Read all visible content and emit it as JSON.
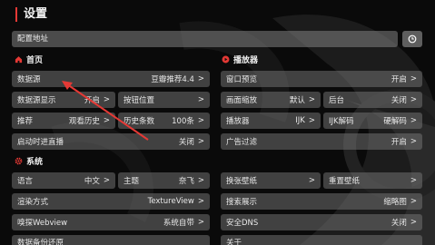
{
  "page_title": "设置",
  "config_address": {
    "label": "配置地址"
  },
  "sections": {
    "home": "首页",
    "player": "播放器",
    "system": "系统"
  },
  "home_rows": [
    {
      "label": "数据源",
      "value": "豆瓣推荐4.4"
    },
    {
      "label": "数据源显示",
      "value": "开启"
    },
    {
      "label": "按钮位置",
      "value": ""
    },
    {
      "label": "推荐",
      "value": "观看历史"
    },
    {
      "label": "历史条数",
      "value": "100条"
    },
    {
      "label": "启动时进直播",
      "value": "关闭"
    }
  ],
  "player_rows": [
    {
      "label": "窗口预览",
      "value": "开启"
    },
    {
      "label": "画面缩放",
      "value": "默认"
    },
    {
      "label": "后台",
      "value": "关闭"
    },
    {
      "label": "播放器",
      "value": "IJK"
    },
    {
      "label": "IJK解码",
      "value": "硬解码"
    },
    {
      "label": "广告过滤",
      "value": "开启"
    }
  ],
  "system_rows": [
    {
      "label": "语言",
      "value": "中文"
    },
    {
      "label": "主题",
      "value": "奈飞"
    },
    {
      "label": "换张壁纸",
      "value": ""
    },
    {
      "label": "重置壁纸",
      "value": ""
    },
    {
      "label": "渲染方式",
      "value": "TextureView"
    },
    {
      "label": "搜索展示",
      "value": "缩略图"
    },
    {
      "label": "嗅探Webview",
      "value": "系统自带"
    },
    {
      "label": "安全DNS",
      "value": "关闭"
    },
    {
      "label": "数据备份还原",
      "value": ""
    },
    {
      "label": "关于",
      "value": ""
    }
  ],
  "arrow_glyph": ">",
  "colors": {
    "accent": "#e53935",
    "row_bg": "#6e6e6e"
  },
  "icons": [
    "history-icon",
    "home-icon",
    "play-circle-icon",
    "gear-icon"
  ]
}
